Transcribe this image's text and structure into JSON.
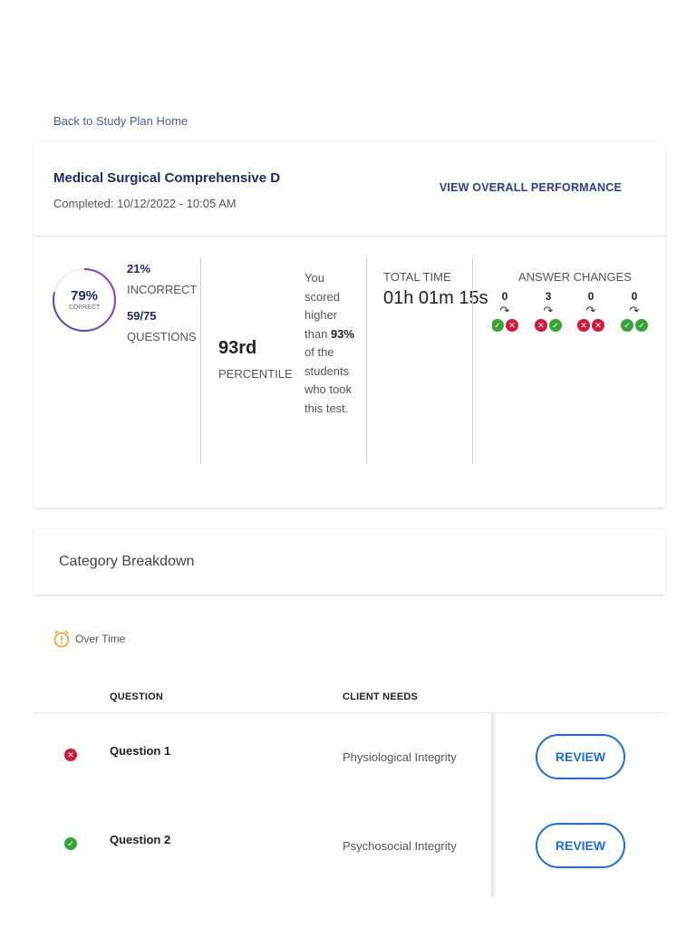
{
  "nav": {
    "back_link": "Back to Study Plan Home"
  },
  "summary": {
    "title": "Medical Surgical Comprehensive D",
    "completed": "Completed: 10/12/2022 - 10:05 AM",
    "view_performance": "VIEW OVERALL PERFORMANCE",
    "score": {
      "percent_correct": "79%",
      "correct_label": "CORRECT",
      "correct_fraction": 0.79
    },
    "incorrect_pct": "21%",
    "incorrect_label": "INCORRECT",
    "questions_count": "59/75",
    "questions_label": "QUESTIONS",
    "percentile_value": "93rd",
    "percentile_label": "PERCENTILE",
    "scored_higher": {
      "before": "You scored higher than",
      "bold": "93%",
      "after": "of the students who took this test."
    },
    "total_time_label": "TOTAL TIME",
    "total_time_value": "01h 01m 15s",
    "answer_changes_label": "ANSWER CHANGES",
    "answer_changes": [
      {
        "count": "0",
        "from": "correct",
        "to": "incorrect"
      },
      {
        "count": "3",
        "from": "incorrect",
        "to": "correct"
      },
      {
        "count": "0",
        "from": "incorrect",
        "to": "incorrect"
      },
      {
        "count": "0",
        "from": "correct",
        "to": "correct"
      }
    ]
  },
  "category": {
    "title": "Category Breakdown"
  },
  "legend": {
    "over_time": "Over Time",
    "icon": "alarm-clock-icon",
    "color": "#f0a020"
  },
  "table": {
    "headers": {
      "question": "QUESTION",
      "client_needs": "CLIENT NEEDS"
    },
    "rows": [
      {
        "status": "incorrect",
        "question": "Question 1",
        "client_needs": "Physiological Integrity",
        "action": "REVIEW"
      },
      {
        "status": "correct",
        "question": "Question 2",
        "client_needs": "Psychosocial Integrity",
        "action": "REVIEW"
      }
    ]
  },
  "colors": {
    "correct": "#37a638",
    "incorrect": "#d0193b",
    "accent": "#1a6ed8",
    "title": "#1f2a6b"
  }
}
